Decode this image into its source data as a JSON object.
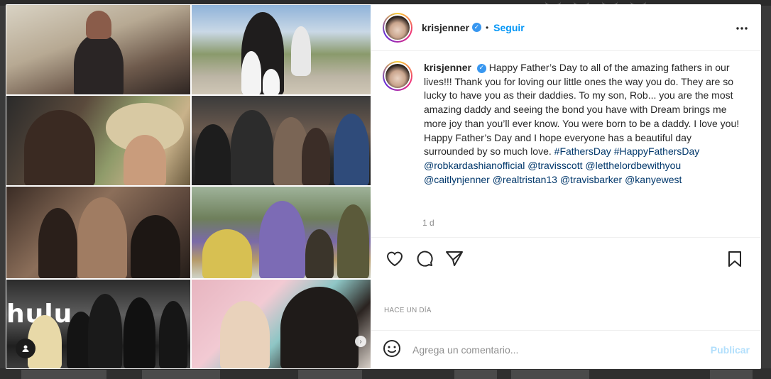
{
  "post": {
    "username": "krisjenner",
    "follow_label": "Seguir",
    "separator": "•",
    "more_label": "•••",
    "caption_parts": {
      "body": "Happy Father’s Day to all of the amazing fathers in our lives!!! Thank you for loving our little ones the way you do. They are so lucky to have you as their daddies. To my son, Rob... you are the most amazing daddy and seeing the bond you have with Dream brings me more joy than you’ll ever know. You were born to be a daddy. I love you! Happy Father’s Day and I hope everyone has a beautiful day surrounded by so much love.",
      "tags": "#FathersDay #HappyFathersDay @robkardashianofficial @travisscott @letthelordbewithyou @caitlynjenner @realtristan13 @travisbarker @kanyewest"
    },
    "time_ago": "1 d",
    "date": "HACE UN DÍA",
    "comment_placeholder": "Agrega un comentario...",
    "publish_label": "Publicar",
    "media_text": "hulu"
  },
  "colors": {
    "link": "#0095f6",
    "hashtag": "#00376b",
    "muted": "#8e8e8e",
    "verified": "#3897f0"
  },
  "icons": [
    "heart-icon",
    "comment-icon",
    "share-icon",
    "bookmark-icon",
    "emoji-icon",
    "verified-badge-icon",
    "more-icon",
    "user-tag-icon",
    "next-arrow-icon"
  ]
}
